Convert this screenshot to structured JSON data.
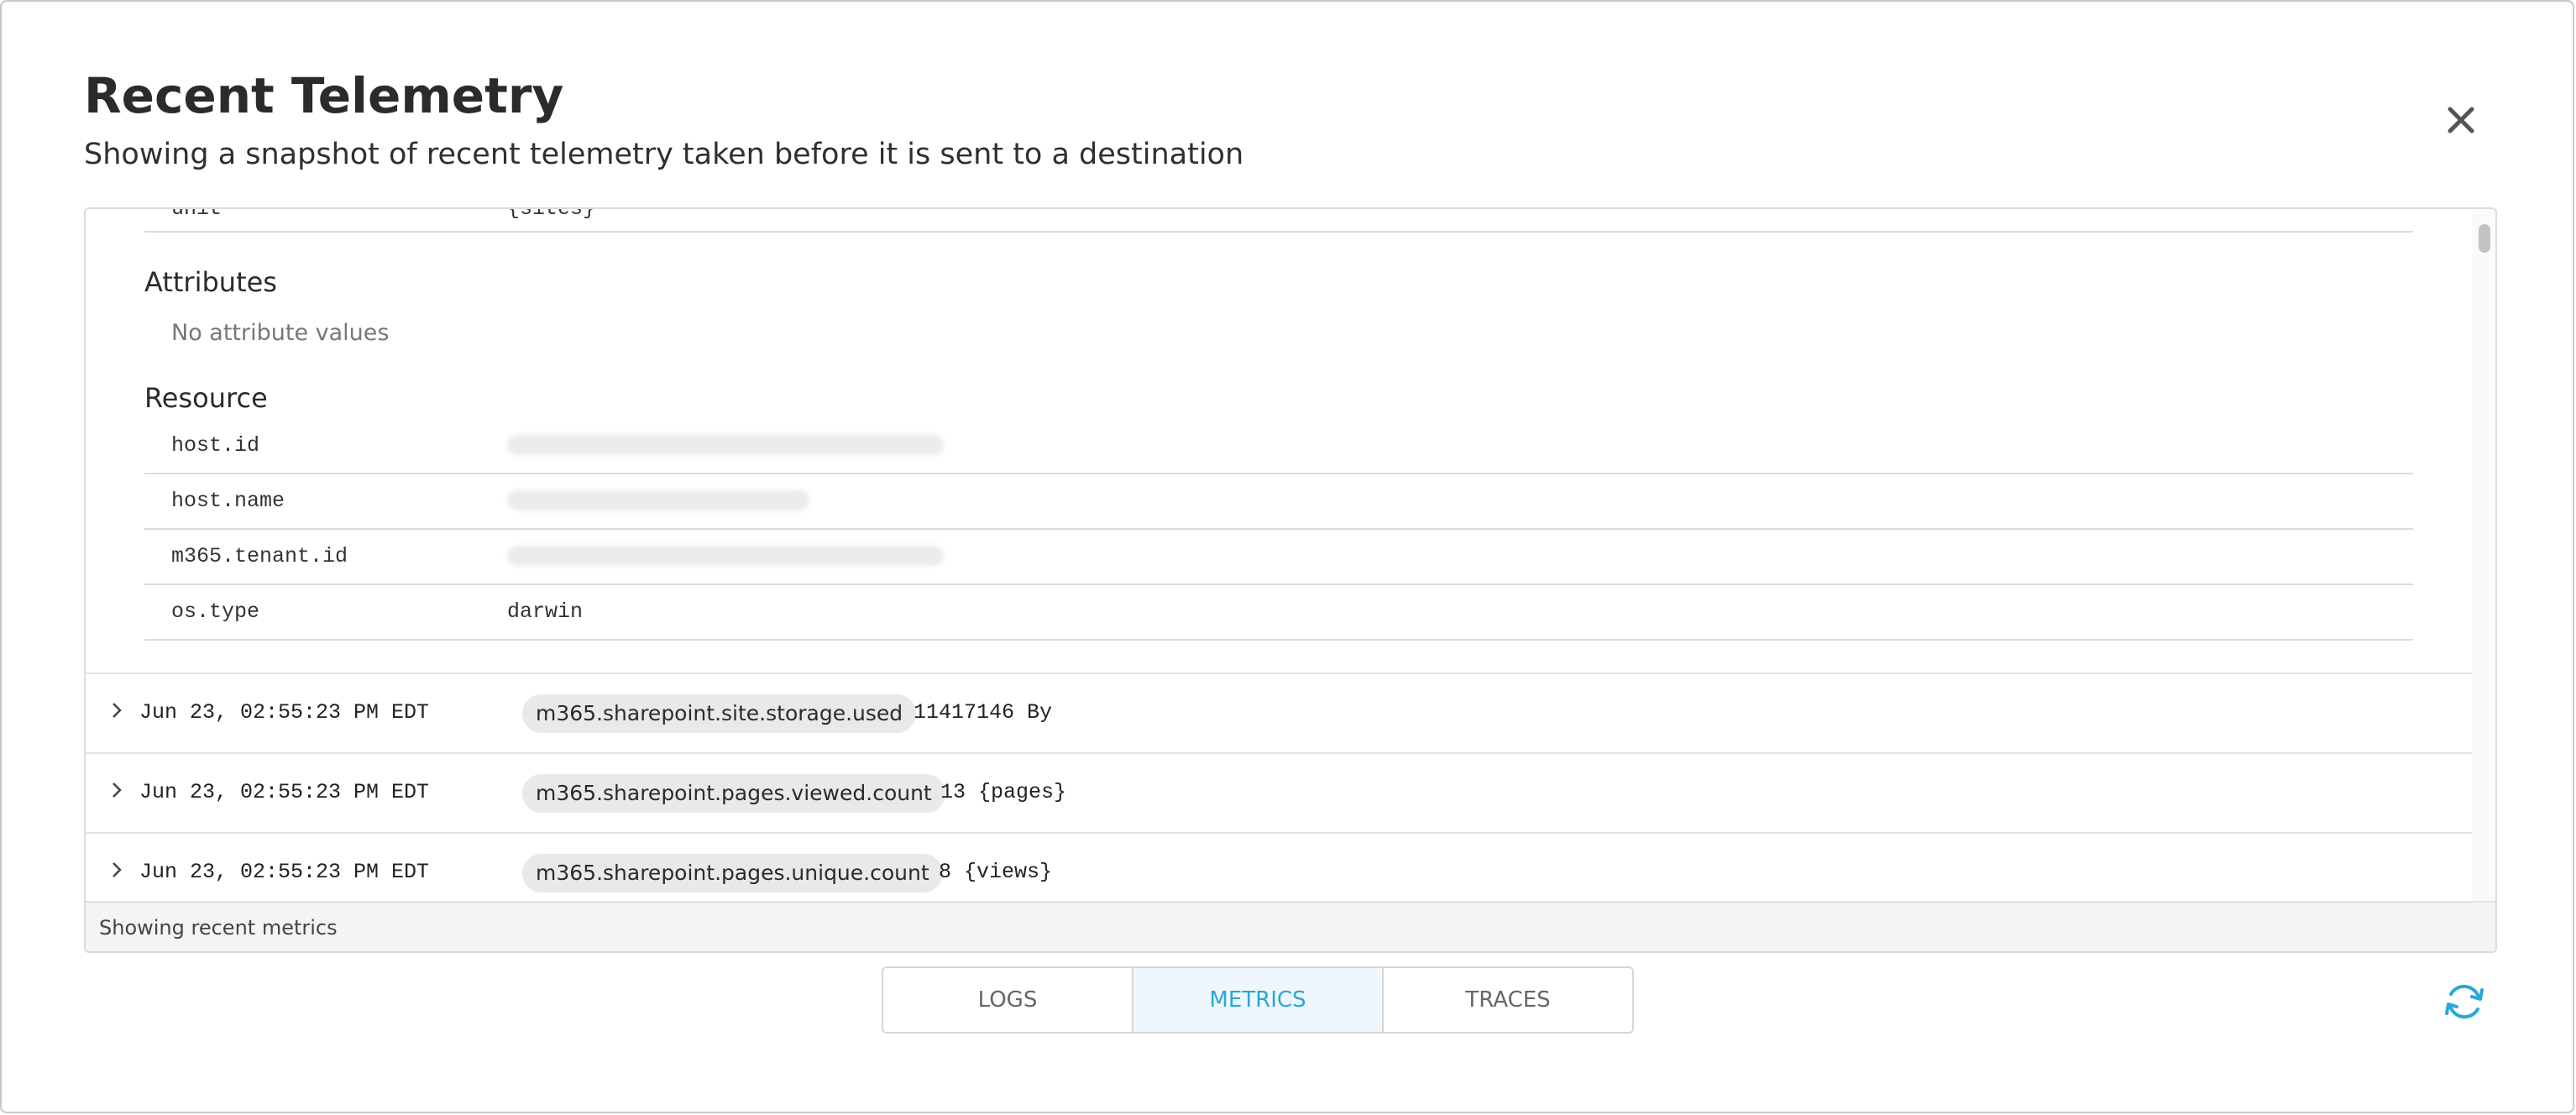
{
  "dialog": {
    "title": "Recent Telemetry",
    "subtitle": "Showing a snapshot of recent telemetry taken before it is sent to a destination",
    "close_icon": "close-icon"
  },
  "expanded_metric": {
    "top_row": {
      "key": "unit",
      "value": "{sites}"
    },
    "attributes_heading": "Attributes",
    "attributes_empty": "No attribute values",
    "resource_heading": "Resource",
    "resource_rows": [
      {
        "key": "host.id",
        "value": "",
        "redacted": true
      },
      {
        "key": "host.name",
        "value": "",
        "redacted": true
      },
      {
        "key": "m365.tenant.id",
        "value": "",
        "redacted": true
      },
      {
        "key": "os.type",
        "value": "darwin",
        "redacted": false
      }
    ]
  },
  "metric_rows": [
    {
      "timestamp": "Jun 23, 02:55:23 PM EDT",
      "name": "m365.sharepoint.site.storage.used",
      "value": "11417146 By"
    },
    {
      "timestamp": "Jun 23, 02:55:23 PM EDT",
      "name": "m365.sharepoint.pages.viewed.count",
      "value": "13 {pages}"
    },
    {
      "timestamp": "Jun 23, 02:55:23 PM EDT",
      "name": "m365.sharepoint.pages.unique.count",
      "value": "8 {views}"
    }
  ],
  "footer": {
    "status": "Showing recent metrics"
  },
  "tabs": [
    {
      "label": "LOGS",
      "active": false
    },
    {
      "label": "METRICS",
      "active": true
    },
    {
      "label": "TRACES",
      "active": false
    }
  ],
  "colors": {
    "accent": "#2aa7d6",
    "active_tab_bg": "#eef7fb"
  },
  "icons": {
    "refresh": "refresh-icon",
    "chevron": "chevron-right-icon"
  }
}
